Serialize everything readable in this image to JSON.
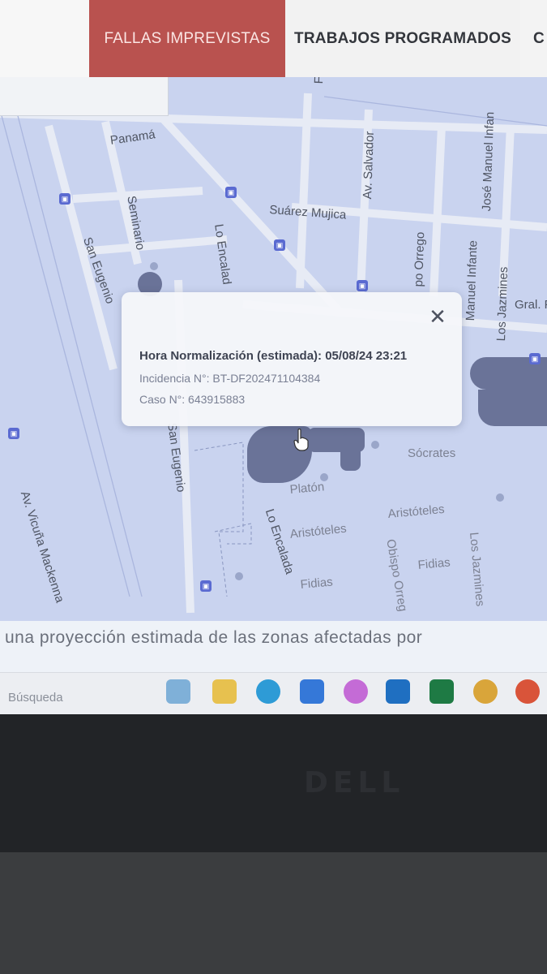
{
  "tabs": {
    "active_label": "FALLAS IMPREVISTAS",
    "second_label": "TRABAJOS PROGRAMADOS",
    "third_label_partial": "C"
  },
  "map": {
    "streets": [
      {
        "name": "Panamá"
      },
      {
        "name": "Suárez Mujica"
      },
      {
        "name": "Av. Salvador"
      },
      {
        "name": "José Manuel Infan"
      },
      {
        "name": "Manuel Infante"
      },
      {
        "name": "Los Jazmines"
      },
      {
        "name": "Gral. F"
      },
      {
        "name": "Seminario"
      },
      {
        "name": "San Eugenio"
      },
      {
        "name": "Lo Encalad"
      },
      {
        "name": "po Orrego"
      },
      {
        "name": "Av. Vicuña Mackenna"
      },
      {
        "name": "San Eugenio"
      },
      {
        "name": "Lo Encalada"
      },
      {
        "name": "Sócrates"
      },
      {
        "name": "Platón"
      },
      {
        "name": "Aristóteles"
      },
      {
        "name": "Aristóteles"
      },
      {
        "name": "Obispo Orreg"
      },
      {
        "name": "Fidias"
      },
      {
        "name": "Fidias"
      },
      {
        "name": "Los Jazmines"
      },
      {
        "name": "Fe"
      }
    ]
  },
  "popup": {
    "title": "Hora Normalización (estimada): 05/08/24 23:21",
    "incidence": "Incidencia N°: BT-DF202471104384",
    "case": "Caso N°: 643915883",
    "close_glyph": "✕"
  },
  "caption": "una proyección estimada de las zonas afectadas por",
  "taskbar": {
    "search_label": "Búsqueda"
  },
  "colors": {
    "accent": "#b9524f",
    "zone": "#6a7398"
  }
}
